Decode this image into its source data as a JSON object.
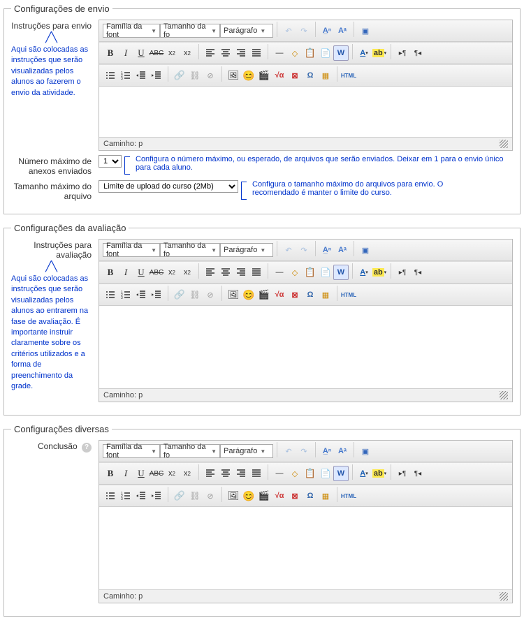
{
  "section1": {
    "legend": "Configurações de envio",
    "label_instructions": "Instruções para envio",
    "help_instructions": "Aqui são colocadas as instruções que serão visualizadas pelos alunos ao fazerem o envio da atividade.",
    "label_max_files": "Número máximo de anexos enviados",
    "max_files_value": "1",
    "help_max_files": "Configura o número máximo, ou esperado, de arquivos que serão enviados. Deixar em 1 para o envio único para cada aluno.",
    "label_max_size": "Tamanho máximo do arquivo",
    "max_size_value": "Limite de upload do curso (2Mb)",
    "help_max_size": "Configura o tamanho máximo do arquivos para envio. O recomendado é manter o limite do curso."
  },
  "section2": {
    "legend": "Configurações da avaliação",
    "label_instructions": "Instruções para avaliação",
    "help_instructions": "Aqui são colocadas as instruções que serão visualizadas pelos alunos ao entrarem na fase de avaliação. É importante instruir claramente sobre os critérios utilizados e a forma de preenchimento da grade."
  },
  "section3": {
    "legend": "Configurações diversas",
    "label_conclusion": "Conclusão"
  },
  "rte": {
    "font_family": "Família da font",
    "font_size": "Tamanho da fo",
    "format": "Parágrafo",
    "path": "Caminho: p"
  },
  "icons": {
    "bold": "B",
    "italic": "I",
    "underline": "U",
    "strike": "ABC",
    "sub": "x₂",
    "sup": "x²",
    "undo": "↶",
    "redo": "↷",
    "find": "🔍",
    "fullscreen": "▣",
    "align_left": "≡",
    "align_center": "≡",
    "align_right": "≡",
    "justify": "≡",
    "hr": "—",
    "eraser": "✏",
    "paste": "📋",
    "paste_text": "📋",
    "paste_word": "W",
    "text_color": "A",
    "bg_color": "ab",
    "ltr": "¶▸",
    "rtl": "◂¶",
    "ul": "≣",
    "ol": "≣",
    "outdent": "◀",
    "indent": "▶",
    "link": "🔗",
    "unlink": "⛓",
    "anchor": "⚓",
    "nolink": "✖",
    "image": "🖼",
    "media": "🎬",
    "emoticon": "😊",
    "charmap": "Ω",
    "table": "▦",
    "sqrt": "√α",
    "html": "HTML",
    "help": "?"
  }
}
